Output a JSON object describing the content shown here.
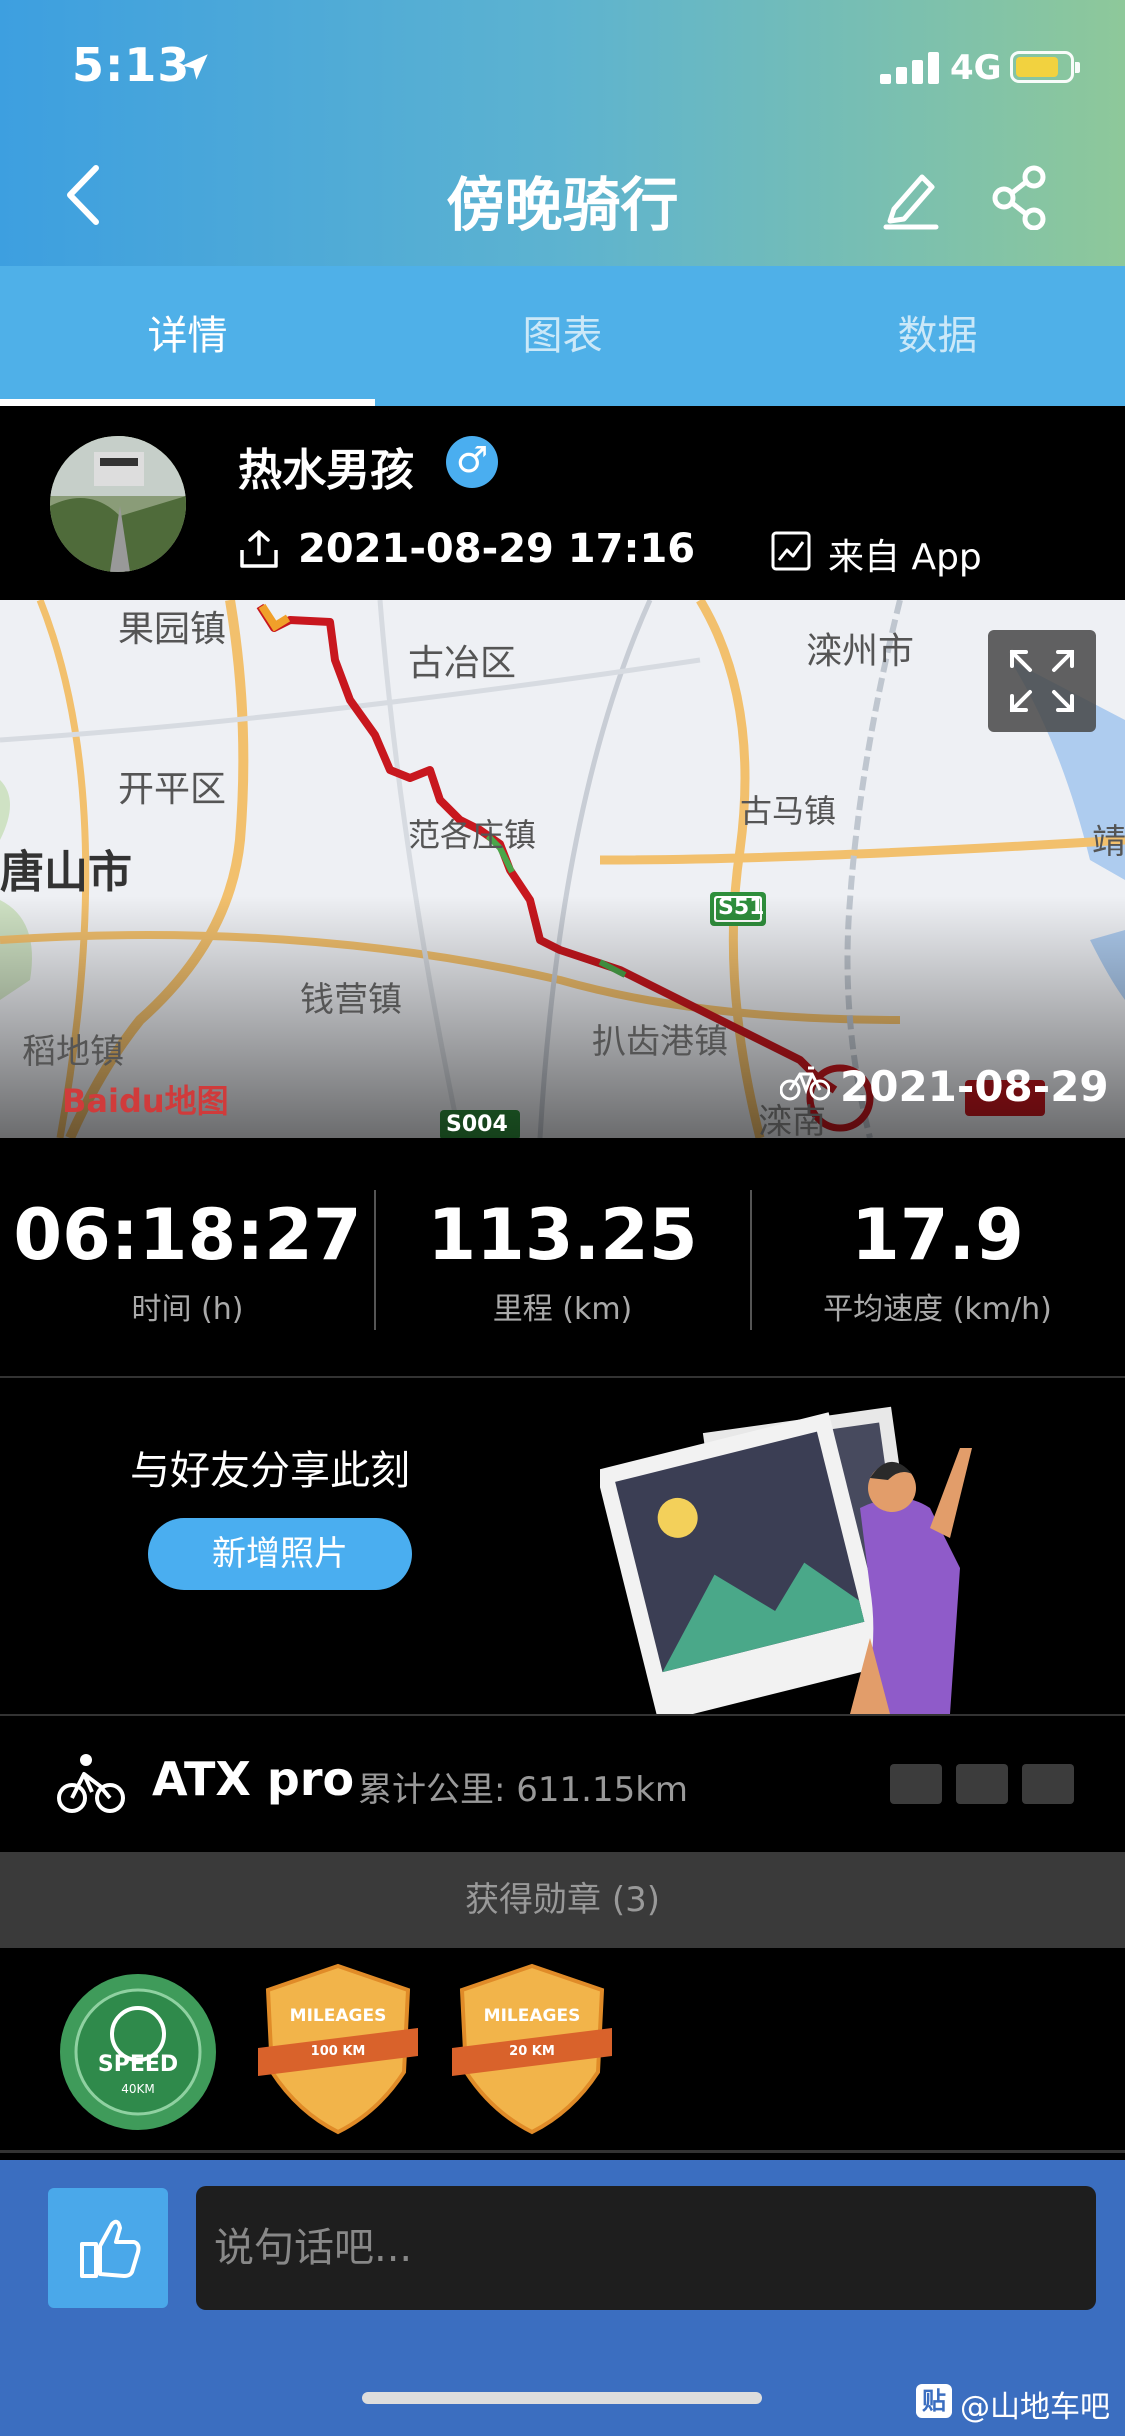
{
  "status_bar": {
    "time": "5:13",
    "network": "4G",
    "battery_color": "#f8d33a"
  },
  "header": {
    "title": "傍晚骑行"
  },
  "tabs": [
    {
      "label": "详情",
      "active": true
    },
    {
      "label": "图表",
      "active": false
    },
    {
      "label": "数据",
      "active": false
    }
  ],
  "user": {
    "name": "热水男孩",
    "gender_symbol": "♂",
    "datetime": "2021-08-29 17:16",
    "source": "来自 App"
  },
  "map": {
    "labels": [
      "果园镇",
      "古冶区",
      "滦州市",
      "开平区",
      "唐山市",
      "范各庄镇",
      "古马镇",
      "S51",
      "钱营镇",
      "稻地镇",
      "扒齿港镇",
      "S004",
      "滦南",
      "靖"
    ],
    "provider": "Baidu地图",
    "ride_date": "2021-08-29",
    "route_color": "#c8171e"
  },
  "stats": [
    {
      "value": "06:18:27",
      "label": "时间 (h)"
    },
    {
      "value": "113.25",
      "label": "里程 (km)"
    },
    {
      "value": "17.9",
      "label": "平均速度 (km/h)"
    }
  ],
  "share": {
    "text": "与好友分享此刻",
    "button": "新增照片"
  },
  "bike": {
    "name": "ATX pro",
    "mileage": "累计公里: 611.15km"
  },
  "medals": {
    "header": "获得勋章 (3)",
    "items": [
      {
        "title": "SPEED",
        "sub": "40KM"
      },
      {
        "title": "MILEAGES",
        "sub": "100 KM"
      },
      {
        "title": "MILEAGES",
        "sub": "20 KM"
      }
    ]
  },
  "comment": {
    "placeholder": "说句话吧..."
  },
  "watermark": {
    "text": "@山地车吧",
    "logo": "贴"
  },
  "colors": {
    "accent": "#4aaef0",
    "bottom_bar": "#3b6ec0"
  }
}
